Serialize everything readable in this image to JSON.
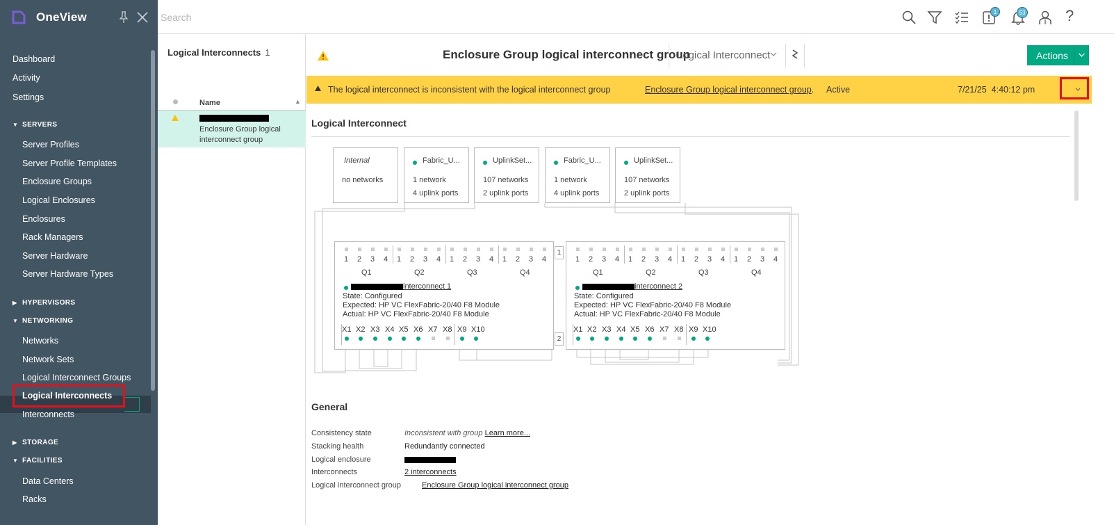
{
  "app": {
    "name": "OneView"
  },
  "sidebar": {
    "top_items": [
      "Dashboard",
      "Activity",
      "Settings"
    ],
    "sections": {
      "servers": {
        "label": "SERVERS",
        "items": [
          "Server Profiles",
          "Server Profile Templates",
          "Enclosure Groups",
          "Logical Enclosures",
          "Enclosures",
          "Rack Managers",
          "Server Hardware",
          "Server Hardware Types"
        ]
      },
      "hypervisors": {
        "label": "HYPERVISORS"
      },
      "networking": {
        "label": "NETWORKING",
        "items": [
          "Networks",
          "Network Sets",
          "Logical Interconnect Groups",
          "Logical Interconnects",
          "Interconnects"
        ],
        "active": "Logical Interconnects"
      },
      "storage": {
        "label": "STORAGE"
      },
      "facilities": {
        "label": "FACILITIES",
        "items": [
          "Data Centers",
          "Racks"
        ]
      }
    },
    "section_glyphs": {
      "expanded": "▼",
      "collapsed": "▶"
    }
  },
  "topbar": {
    "search_placeholder": "Search",
    "icons": [
      "search-icon",
      "filter-icon",
      "checklist-icon",
      "alerts-icon",
      "notifications-icon",
      "user-icon",
      "help-icon"
    ],
    "alerts_badge": "1",
    "notifications_badge": "53",
    "help_glyph": "?"
  },
  "master": {
    "title": "Logical Interconnects",
    "count": "1",
    "column_name": "Name",
    "sort_glyph": "▲",
    "row": {
      "subtitle": "Enclosure Group logical interconnect group"
    }
  },
  "detail": {
    "title": "Enclosure Group logical interconnect group",
    "view_selector": "Logical Interconnect",
    "actions_label": "Actions",
    "alert": {
      "message": "The logical interconnect is inconsistent with the logical interconnect group",
      "link": "Enclosure Group logical interconnect group",
      "link_suffix": ".",
      "status": "Active",
      "date": "7/21/25",
      "time": "4:40:12 pm"
    },
    "logical_interconnect": {
      "title": "Logical Interconnect",
      "uplink_sets": [
        {
          "name": "Internal",
          "line1": "no networks",
          "line2": "",
          "status": "none"
        },
        {
          "name": "Fabric_U...",
          "line1": "1 network",
          "line2": "4 uplink ports",
          "status": "ok"
        },
        {
          "name": "UplinkSet...",
          "line1": "107 networks",
          "line2": "2 uplink ports",
          "status": "ok"
        },
        {
          "name": "Fabric_U...",
          "line1": "1 network",
          "line2": "4 uplink ports",
          "status": "ok"
        },
        {
          "name": "UplinkSet...",
          "line1": "107 networks",
          "line2": "2 uplink ports",
          "status": "ok"
        }
      ],
      "port_numbers": [
        "1",
        "2",
        "3",
        "4"
      ],
      "quads": [
        "Q1",
        "Q2",
        "Q3",
        "Q4"
      ],
      "x_ports": [
        "X1",
        "X2",
        "X3",
        "X4",
        "X5",
        "X6",
        "X7",
        "X8",
        "X9",
        "X10"
      ],
      "x_port_connected": [
        true,
        true,
        true,
        true,
        true,
        true,
        false,
        false,
        true,
        true
      ],
      "interconnects": [
        {
          "link_suffix": "interconnect 1",
          "state": "State: Configured",
          "expected": "Expected: HP VC FlexFabric-20/40 F8 Module",
          "actual": "Actual: HP VC FlexFabric-20/40 F8 Module",
          "bay": "1"
        },
        {
          "link_suffix": "interconnect 2",
          "state": "State: Configured",
          "expected": "Expected: HP VC FlexFabric-20/40 F8 Module",
          "actual": "Actual: HP VC FlexFabric-20/40 F8 Module",
          "bay": "2"
        }
      ]
    },
    "general": {
      "title": "General",
      "consistency_label": "Consistency state",
      "consistency_value": "Inconsistent with group",
      "consistency_link": "Learn more...",
      "stacking_label": "Stacking health",
      "stacking_value": "Redundantly connected",
      "enclosure_label": "Logical enclosure",
      "interconnects_label": "Interconnects",
      "interconnects_value": "2 interconnects",
      "lig_label": "Logical interconnect group",
      "lig_value": "Enclosure Group logical interconnect group"
    }
  },
  "colors": {
    "sidebar": "#425563",
    "accent": "#01a982",
    "alert": "#ffd144",
    "highlight": "#e2111c"
  }
}
